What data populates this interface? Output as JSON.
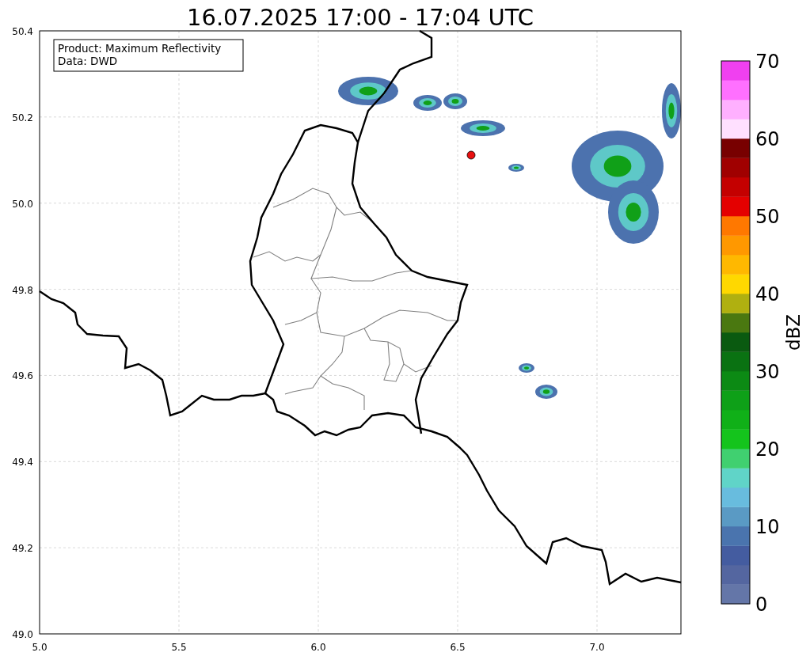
{
  "title": "16.07.2025 17:00 - 17:04 UTC",
  "info_box": [
    "Product: Maximum Reflectivity",
    "Data: DWD"
  ],
  "map": {
    "xticks": [
      "5.0",
      "5.5",
      "6.0",
      "6.5",
      "7.0"
    ],
    "yticks": [
      "50.4",
      "50.2",
      "50.0",
      "49.8",
      "49.6",
      "49.4",
      "49.2",
      "49.0"
    ]
  },
  "colorbar": {
    "label": "dBZ",
    "ticks": [
      "70",
      "60",
      "50",
      "40",
      "30",
      "20",
      "10",
      "0"
    ],
    "segments": [
      {
        "color": "#6476a8"
      },
      {
        "color": "#5466a0"
      },
      {
        "color": "#445ca0"
      },
      {
        "color": "#4a74ae"
      },
      {
        "color": "#5a9ac4"
      },
      {
        "color": "#68bcde"
      },
      {
        "color": "#60d4c8"
      },
      {
        "color": "#40d070"
      },
      {
        "color": "#14c41c"
      },
      {
        "color": "#10b018"
      },
      {
        "color": "#0ea018"
      },
      {
        "color": "#0c8a14"
      },
      {
        "color": "#0a7212"
      },
      {
        "color": "#0a5a10"
      },
      {
        "color": "#4a7810"
      },
      {
        "color": "#b0b010"
      },
      {
        "color": "#ffd800"
      },
      {
        "color": "#ffb800"
      },
      {
        "color": "#ff9800"
      },
      {
        "color": "#ff7800"
      },
      {
        "color": "#e40000"
      },
      {
        "color": "#c40000"
      },
      {
        "color": "#a00000"
      },
      {
        "color": "#780000"
      },
      {
        "color": "#ffe0ff"
      },
      {
        "color": "#ffb0ff"
      },
      {
        "color": "#ff70ff"
      },
      {
        "color": "#f040f0"
      }
    ]
  }
}
